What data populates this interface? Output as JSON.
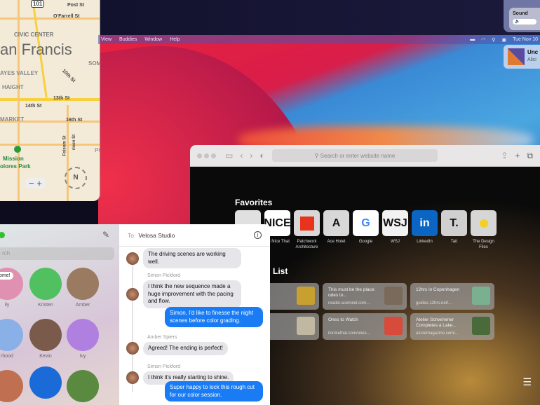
{
  "maps": {
    "labels": [
      "101",
      "Post St",
      "O'Farrell St",
      "CIVIC CENTER",
      "an Francis",
      "SOM",
      "AYES VALLEY",
      "HAIGHT",
      "10th St",
      "13th St",
      "14th St",
      "MARKET",
      "16th St",
      "Folsom St",
      "rison St",
      "PO",
      "Mission",
      "olores Park"
    ],
    "zoom_out": "−",
    "zoom_in": "+",
    "compass": "N"
  },
  "menubar": {
    "items": [
      "View",
      "Buddies",
      "Window",
      "Help"
    ],
    "clock": "Tue Nov 10"
  },
  "control_center": {
    "sound_label": "Sound",
    "now_playing_title": "Unc",
    "now_playing_artist": "Alici"
  },
  "safari": {
    "address_placeholder": "Search or enter website name",
    "favorites_title": "Favorites",
    "favorites": [
      {
        "label": "",
        "tile": ""
      },
      {
        "label": "It's Nice That",
        "tile": "NICE"
      },
      {
        "label": "Patchwork Architecture",
        "tile": ""
      },
      {
        "label": "Ace Hotel",
        "tile": "A"
      },
      {
        "label": "Google",
        "tile": "G"
      },
      {
        "label": "WSJ",
        "tile": "WSJ"
      },
      {
        "label": "LinkedIn",
        "tile": "in"
      },
      {
        "label": "Tait",
        "tile": "T."
      },
      {
        "label": "The Design Files",
        "tile": ""
      }
    ],
    "reading_list_title": "List",
    "reading_list": [
      {
        "title": "In...",
        "url": "...ryroads..."
      },
      {
        "title": "This must be the place: odes to...",
        "url": "reader.acehotel.com..."
      },
      {
        "title": "12hrs in Copenhagen",
        "url": "guides.12hrs.net/..."
      },
      {
        "title": "...avan, ...de",
        "url": "...agazine..."
      },
      {
        "title": "Ones to Watch",
        "url": "itsnicethat.com/ones..."
      },
      {
        "title": "Atelier Schwimmer Completes a Lake...",
        "url": "azuremagazine.com/..."
      }
    ]
  },
  "messages": {
    "search_placeholder": "rch",
    "to_label": "To:",
    "recipient": "Velosa Studio",
    "pins": [
      {
        "name": "ily",
        "badge": "Home!"
      },
      {
        "name": "Kristen"
      },
      {
        "name": "Amber"
      },
      {
        "name": "rhood"
      },
      {
        "name": "Kevin"
      },
      {
        "name": "Ivy"
      }
    ],
    "thread": [
      {
        "sender": "",
        "text": "The driving scenes are working well.",
        "me": false
      },
      {
        "sender": "Simon Pickford",
        "text": "I think the new sequence made a huge improvement with the pacing and flow.",
        "me": false
      },
      {
        "sender": "",
        "text": "Simon, I'd like to finesse the night scenes before color grading.",
        "me": true
      },
      {
        "sender": "Amber Spiers",
        "text": "Agreed! The ending is perfect!",
        "me": false
      },
      {
        "sender": "Simon Pickford",
        "text": "I think it's really starting to shine.",
        "me": false
      },
      {
        "sender": "",
        "text": "Super happy to lock this rough cut for our color session.",
        "me": true
      }
    ]
  }
}
